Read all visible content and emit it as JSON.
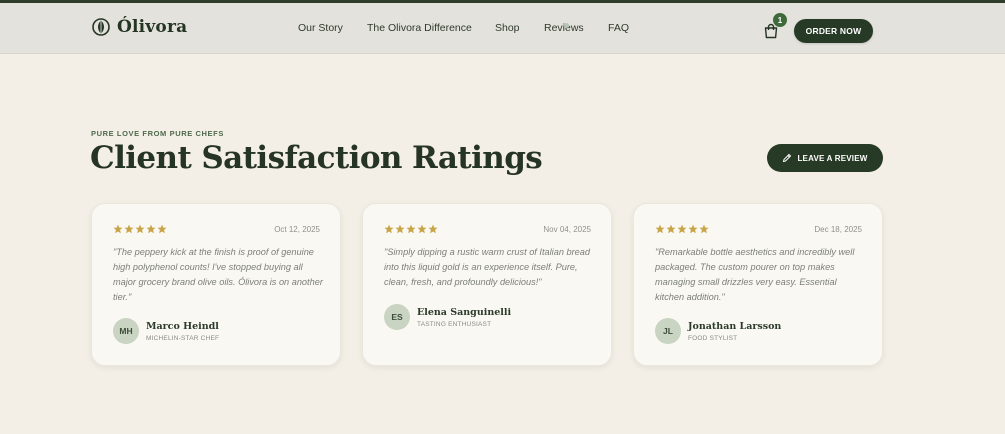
{
  "brand": {
    "name": "Ólivora",
    "logo_icon": "olive-leaf-icon"
  },
  "nav": {
    "items": [
      {
        "label": "Our Story"
      },
      {
        "label": "The Olivora Difference"
      },
      {
        "label": "Shop"
      },
      {
        "label": "Reviews"
      },
      {
        "label": "FAQ"
      }
    ]
  },
  "cart": {
    "icon": "shopping-bag-icon",
    "count": "1"
  },
  "header": {
    "order_label": "ORDER NOW"
  },
  "section": {
    "eyebrow": "PURE LOVE FROM PURE CHEFS",
    "title": "Client Satisfaction Ratings",
    "review_button_label": "LEAVE A REVIEW",
    "review_button_icon": "pen-icon"
  },
  "reviews": [
    {
      "rating": 5,
      "date": "Oct 12, 2025",
      "quote": "\"The peppery kick at the finish is proof of genuine high polyphenol counts! I've stopped buying all major grocery brand olive oils. Ólivora is on another tier.\"",
      "initials": "MH",
      "name": "Marco Heindl",
      "role": "MICHELIN-STAR CHEF"
    },
    {
      "rating": 5,
      "date": "Nov 04, 2025",
      "quote": "\"Simply dipping a rustic warm crust of Italian bread into this liquid gold is an experience itself. Pure, clean, fresh, and profoundly delicious!\"",
      "initials": "ES",
      "name": "Elena Sanguinelli",
      "role": "TASTING ENTHUSIAST"
    },
    {
      "rating": 5,
      "date": "Dec 18, 2025",
      "quote": "\"Remarkable bottle aesthetics and incredibly well packaged. The custom pourer on top makes managing small drizzles very easy. Essential kitchen addition.\"",
      "initials": "JL",
      "name": "Jonathan Larsson",
      "role": "FOOD STYLIST"
    }
  ],
  "colors": {
    "accent_dark": "#263a25",
    "star": "#c9a54a",
    "background": "#f3efe6"
  }
}
